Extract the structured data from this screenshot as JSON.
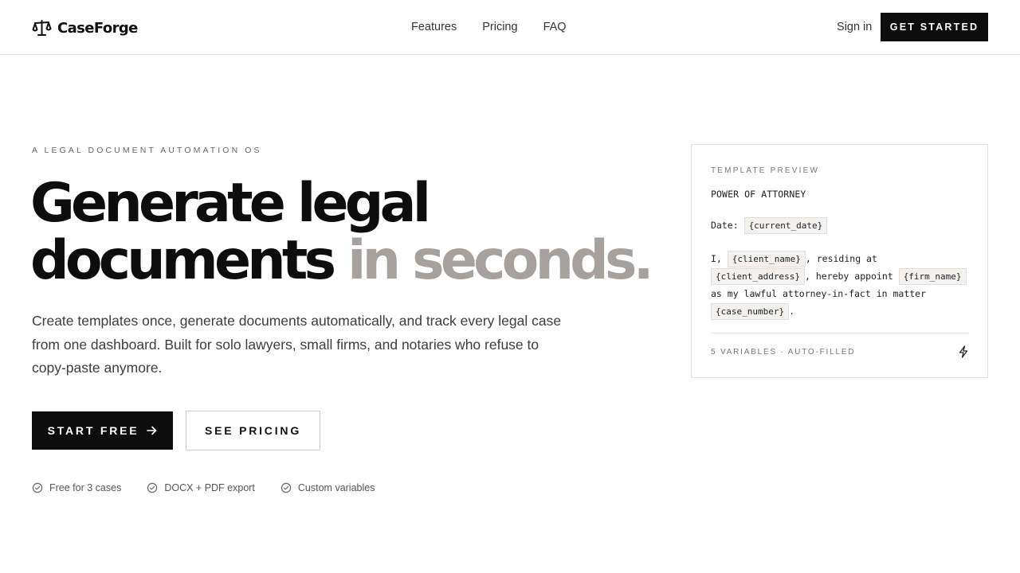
{
  "header": {
    "brand": "CaseForge",
    "logo_icon": "scales-icon",
    "nav": [
      "Features",
      "Pricing",
      "FAQ"
    ],
    "signin_label": "Sign in",
    "cta_label": "GET STARTED"
  },
  "hero": {
    "eyebrow": "A LEGAL DOCUMENT AUTOMATION OS",
    "headline_line1": "Generate legal",
    "headline_line2_dark": "documents",
    "headline_line2_muted": "in seconds.",
    "subtitle": "Create templates once, generate documents automatically, and track every legal case from one dashboard. Built for solo lawyers, small firms, and notaries who refuse to copy-paste anymore.",
    "primary_cta": "START FREE",
    "primary_cta_icon": "arrow-right-icon",
    "secondary_cta": "SEE PRICING",
    "features": [
      "Free for 3 cases",
      "DOCX + PDF export",
      "Custom variables"
    ]
  },
  "preview": {
    "label": "TEMPLATE PREVIEW",
    "doc_title": "POWER OF ATTORNEY",
    "date_label": "Date:",
    "date_var": "{current_date}",
    "text_1": "I,",
    "var_client_name": "{client_name}",
    "text_2": ", residing at",
    "var_client_address": "{client_address}",
    "text_3": ", hereby appoint",
    "var_firm_name": "{firm_name}",
    "text_4": "as my lawful attorney-in-fact in matter",
    "var_case_number": "{case_number}",
    "text_5": ".",
    "footer": "5 VARIABLES · AUTO-FILLED",
    "footer_icon": "lightning-bolt-icon"
  },
  "colors": {
    "primary": "#0d0d0d",
    "muted_headline": "#a6a09e",
    "border": "#e5e5e5",
    "chip_bg": "#f3f2f1"
  }
}
